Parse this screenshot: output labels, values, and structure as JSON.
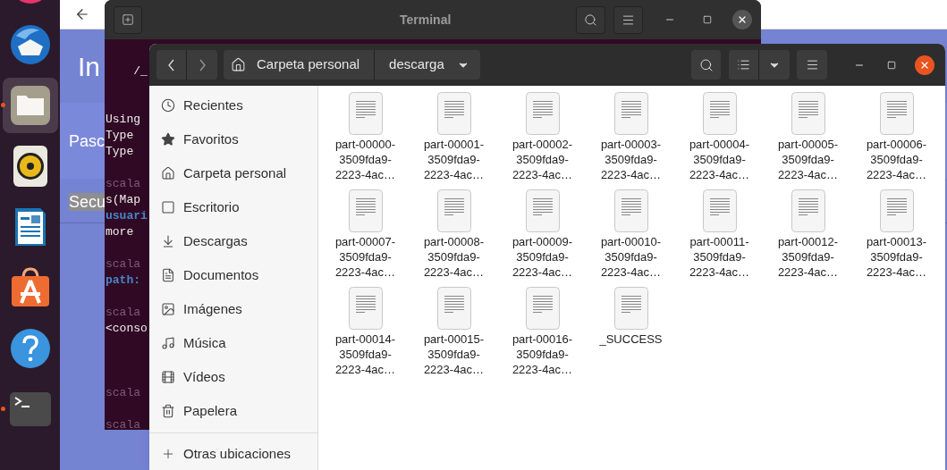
{
  "dock": {
    "apps": [
      {
        "kind": "browser",
        "selected": false
      },
      {
        "kind": "mail",
        "selected": false,
        "running": false
      },
      {
        "kind": "files",
        "selected": true,
        "running": true
      },
      {
        "kind": "music",
        "selected": false,
        "running": false
      },
      {
        "kind": "writer",
        "selected": false,
        "running": false
      },
      {
        "kind": "software",
        "selected": false,
        "running": false
      },
      {
        "kind": "help",
        "selected": false,
        "running": false
      },
      {
        "kind": "terminal",
        "selected": false,
        "running": true
      }
    ]
  },
  "browser": {
    "heading": "In",
    "items": [
      {
        "label": "Pasc",
        "highlighted": false
      },
      {
        "label": "Secu",
        "highlighted": true
      }
    ]
  },
  "terminal": {
    "title": "Terminal",
    "lines": [
      {
        "kind": "output",
        "text": "    /_"
      },
      {
        "kind": "blank"
      },
      {
        "kind": "blank"
      },
      {
        "kind": "output",
        "text": "Using"
      },
      {
        "kind": "output",
        "text": "Type"
      },
      {
        "kind": "output",
        "text": "Type"
      },
      {
        "kind": "blank"
      },
      {
        "kind": "prompt",
        "text": "scala"
      },
      {
        "kind": "output",
        "text": "s(Map"
      },
      {
        "kind": "value",
        "text": "usuari"
      },
      {
        "kind": "output",
        "text": "more"
      },
      {
        "kind": "blank"
      },
      {
        "kind": "prompt",
        "text": "scala"
      },
      {
        "kind": "value",
        "text": "path:"
      },
      {
        "kind": "blank"
      },
      {
        "kind": "prompt",
        "text": "scala"
      },
      {
        "kind": "output",
        "text": "<conso"
      },
      {
        "kind": "blank"
      },
      {
        "kind": "blank"
      },
      {
        "kind": "blank"
      },
      {
        "kind": "prompt",
        "text": "scala"
      },
      {
        "kind": "blank"
      },
      {
        "kind": "prompt",
        "text": "scala"
      }
    ]
  },
  "files": {
    "path": [
      {
        "kind": "home",
        "label": "Carpeta personal"
      },
      {
        "kind": "current",
        "label": "descarga"
      }
    ],
    "sidebar": {
      "items": [
        {
          "kind": "recent",
          "label": "Recientes"
        },
        {
          "kind": "starred",
          "label": "Favoritos"
        },
        {
          "kind": "home",
          "label": "Carpeta personal"
        },
        {
          "kind": "desktop",
          "label": "Escritorio"
        },
        {
          "kind": "downloads",
          "label": "Descargas"
        },
        {
          "kind": "documents",
          "label": "Documentos"
        },
        {
          "kind": "pictures",
          "label": "Imágenes"
        },
        {
          "kind": "music",
          "label": "Música"
        },
        {
          "kind": "videos",
          "label": "Vídeos"
        },
        {
          "kind": "trash",
          "label": "Papelera"
        }
      ],
      "other": {
        "label": "Otras ubicaciones"
      }
    },
    "items": [
      {
        "name": "part-00000-3509fda9-2223-4ac…"
      },
      {
        "name": "part-00001-3509fda9-2223-4ac…"
      },
      {
        "name": "part-00002-3509fda9-2223-4ac…"
      },
      {
        "name": "part-00003-3509fda9-2223-4ac…"
      },
      {
        "name": "part-00004-3509fda9-2223-4ac…"
      },
      {
        "name": "part-00005-3509fda9-2223-4ac…"
      },
      {
        "name": "part-00006-3509fda9-2223-4ac…"
      },
      {
        "name": "part-00007-3509fda9-2223-4ac…"
      },
      {
        "name": "part-00008-3509fda9-2223-4ac…"
      },
      {
        "name": "part-00009-3509fda9-2223-4ac…"
      },
      {
        "name": "part-00010-3509fda9-2223-4ac…"
      },
      {
        "name": "part-00011-3509fda9-2223-4ac…"
      },
      {
        "name": "part-00012-3509fda9-2223-4ac…"
      },
      {
        "name": "part-00013-3509fda9-2223-4ac…"
      },
      {
        "name": "part-00014-3509fda9-2223-4ac…"
      },
      {
        "name": "part-00015-3509fda9-2223-4ac…"
      },
      {
        "name": "part-00016-3509fda9-2223-4ac…"
      },
      {
        "name": "_SUCCESS"
      }
    ]
  }
}
